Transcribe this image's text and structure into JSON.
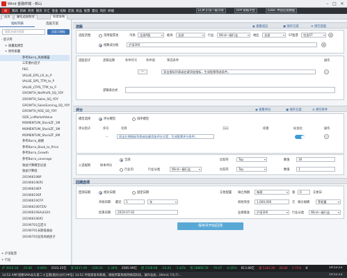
{
  "window": {
    "title": "Wind 金融终端 - 新山"
  },
  "menubar": {
    "logo": "W",
    "items": [
      "我的",
      "新闻",
      "债券",
      "期货",
      "外汇",
      "基金",
      "指数",
      "宏观",
      "商品",
      "股票",
      "量化",
      "风控",
      "终端"
    ],
    "right_tabs": [
      "ECM 沪深一级市场",
      "RPP 研报平台",
      "EDBC 中国宏观数据"
    ]
  },
  "tabs": [
    "首页",
    "量化选股框架",
    "新建策略"
  ],
  "sidebar": {
    "tab_left": "指标列表",
    "tab_right": "选股方案",
    "search_placeholder": "搜索关键字搜索",
    "add_button": "自定义指标",
    "items": [
      "- 因子库",
      "+ 质量类模型",
      "+ 财务质量",
      "参考Barra_风格暴露",
      "三年要价因子",
      "PEG",
      "VALUE_EPS_LR_to_P",
      "VALUE_SPS_TTM_to_P",
      "VALUE_CFPS_TTM_to_P",
      "GROWTH_NetProfit_SQ_YOY",
      "GROWTH_Sales_SQ_YOY",
      "GROWTH_SalesEarning_SQ_YOY",
      "GROWTH_ROE_SQ_YOY",
      "SIZE_LnMarketValue",
      "MOMENTUM_StockZF_1M",
      "MOMENTUM_StockZF_3M",
      "MOMENTUM_StockZF_6M",
      "参考Barra_规模",
      "参考Barra_Book_to_Price",
      "参考Barra_Growth",
      "参考Barra_Leverage",
      "收益计算模型过滤",
      "收益计算组",
      "20190619BP",
      "20190619EP2",
      "20190619EP",
      "20190619SP",
      "20190619CFP",
      "20190619DTZIV",
      "20190619SALEGIV",
      "20190619EP2",
      "20190701自定义",
      "20190701长期低收益",
      "20190701投资风格因子"
    ],
    "footer_items": [
      "+ 沪深股票",
      "+ 行业"
    ],
    "selected_index": 3
  },
  "stock_pool": {
    "title": "选股",
    "buttons": [
      "查看成员",
      "保存方案",
      "清空选股"
    ],
    "scope_label": "选股范围",
    "mode_options": [
      "常用股票池",
      "自定义股票池"
    ],
    "market_label": "市场",
    "market_value": "全部A股",
    "board_label": "板块",
    "board_value": "全部",
    "industry_label": "行业",
    "industry_value": "Wind一级行业",
    "region_label": "地区",
    "region_value": "全部",
    "st_label": "ST股票",
    "st_value": "包含ST",
    "index_option": "指数成分股",
    "index_value": "沪深300"
  },
  "factor_filter": {
    "label": "选股因子",
    "columns": [
      "逻辑运算",
      "条件符号",
      "条件值",
      "筛选条件"
    ],
    "op_column": "操作",
    "row_op": "--",
    "row_text": "双击指标列表或右键添加指标，生成股票筛选条件。",
    "formula_label": "逻辑表达式"
  },
  "scoring": {
    "title": "评分",
    "buttons": [
      "查看评分",
      "保存方案",
      "清空条件"
    ],
    "mode_label": "模型选择",
    "mode_options": [
      "评分模型",
      "排序模型"
    ],
    "factor_label": "评分因子",
    "columns": [
      "序号",
      "名称",
      "方向",
      "权重",
      "标准化",
      "操作"
    ],
    "row_num": "--",
    "row_text": "双击左侧指标列表或右键添加评分方案，生成股票评分条件。",
    "industry_label": "入选规则",
    "industry_sub": "样本评分",
    "scope_all": "全部",
    "scope_industry": "行业内",
    "industry_class_label": "行业分类",
    "industry_class_value": "Wind一级行业",
    "compare_label": "比较符",
    "compare_value": "Top",
    "count_label": "数值",
    "count_value": "30",
    "compare_label2": "比较符",
    "compare_value2": "Top",
    "count_label2": "数值",
    "count_value2": "1"
  },
  "backtest": {
    "title": "回测选项",
    "date_label": "回测日期",
    "date_options": [
      "相对日期",
      "固定日期"
    ],
    "start_label": "开始日期",
    "period_label": "最近",
    "period_num": "1",
    "period_unit": "年",
    "end_label": "结束日期",
    "end_value": "2019-07-02",
    "trade_label": "交易配置",
    "rebalance_label": "调仓周期",
    "rebalance_value": "每周",
    "day_label": "第",
    "day_value": "0",
    "day_suffix": "交易日",
    "capital_label": "初始资金",
    "capital_value": "1,000,000",
    "cost_label": "元",
    "weight_label": "调仓规模",
    "weight_value": "等权重",
    "benchmark_label": "业绩基准",
    "benchmark_value": "沪深300",
    "industry_label": "行业分类",
    "industry_value": "Wind一级行业",
    "save_button": "保存并开始回测"
  },
  "status": {
    "line1": [
      {
        "text": "沪 3014.34",
        "c": "g"
      },
      {
        "text": "-25.80",
        "c": "g"
      },
      {
        "text": "-0.80%",
        "c": "g"
      },
      {
        "text": "2103.35亿",
        "c": "w"
      },
      {
        "text": "深 9417.49",
        "c": "g"
      },
      {
        "text": "-128.03",
        "c": "g"
      },
      {
        "text": "-1.34%",
        "c": "g"
      },
      {
        "text": "2585.99亿",
        "c": "w"
      },
      {
        "text": "创 1528.68",
        "c": "g"
      },
      {
        "text": "-22.01",
        "c": "g"
      },
      {
        "text": "-1.42%",
        "c": "g"
      },
      {
        "text": "恒 28806.59",
        "c": "g"
      },
      {
        "text": "-70.07",
        "c": "g"
      },
      {
        "text": "-0.25%",
        "c": "g"
      },
      {
        "text": "813.80亿",
        "c": "w"
      },
      {
        "text": "道 1343.39",
        "c": "r"
      },
      {
        "text": "26.82",
        "c": "r"
      },
      {
        "text": "1.71%",
        "c": "r"
      },
      {
        "text": "836.46亿",
        "c": "w"
      }
    ],
    "time": "14:52:23",
    "line2": "14:52  AMF道德SMA永久第二十五期(股份)分行(中信)     14:52  环保部发布新规，请按所属系统转换成科技，操作会此...(Wind)     7/1/7/...",
    "line2_time": "14:52:23"
  }
}
